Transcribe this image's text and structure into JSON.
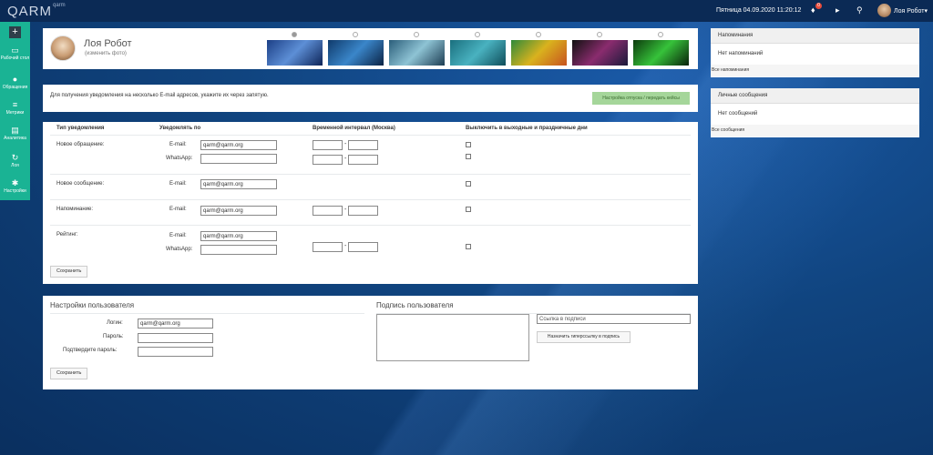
{
  "app": {
    "logo": "QARM",
    "logo_sub": "qarm"
  },
  "topbar": {
    "datetime": "Пятница 04.09.2020 11:20:12",
    "bell_count": "0",
    "user_name": "Лоя Робот",
    "caret": "▾"
  },
  "sidebar": {
    "add_label": "+",
    "items": [
      {
        "label": "Рабочий стол",
        "icon": "monitor-icon",
        "glyph": "▭"
      },
      {
        "label": "Обращения",
        "icon": "comment-icon",
        "glyph": "●"
      },
      {
        "label": "Метрики",
        "icon": "list-icon",
        "glyph": "≡"
      },
      {
        "label": "Аналитика",
        "icon": "chart-icon",
        "glyph": "▤"
      },
      {
        "label": "Лоя",
        "icon": "refresh-icon",
        "glyph": "↻"
      },
      {
        "label": "Настройки",
        "icon": "gear-icon",
        "glyph": "✱"
      }
    ]
  },
  "profile": {
    "name": "Лоя Робот",
    "change_photo": "(изменить фото)",
    "themes": [
      {
        "selected": true,
        "colors": [
          "#1c3f86",
          "#5d8fd6",
          "#0d2457"
        ]
      },
      {
        "selected": false,
        "colors": [
          "#0f3a6b",
          "#3a86c9",
          "#0b2344"
        ]
      },
      {
        "selected": false,
        "colors": [
          "#2a5d7a",
          "#8ec3d4",
          "#1d3d52"
        ]
      },
      {
        "selected": false,
        "colors": [
          "#1a6f7e",
          "#49b2c0",
          "#0f4d5a"
        ]
      },
      {
        "selected": false,
        "colors": [
          "#2e8a3a",
          "#d9b21e",
          "#c7531f"
        ]
      },
      {
        "selected": false,
        "colors": [
          "#111111",
          "#8a2c6e",
          "#1a1a3a"
        ]
      },
      {
        "selected": false,
        "colors": [
          "#0d3a0d",
          "#36c23a",
          "#0a220a"
        ]
      }
    ]
  },
  "notice": {
    "text": "Для получения уведомления на несколько E-mail адресов, укажите их через запятую.",
    "button": "Настройка отпуска / передать кейсы"
  },
  "notify": {
    "headers": {
      "type": "Тип уведомления",
      "notify_by": "Уведомлять по",
      "interval": "Временной интервал (Москва)",
      "weekends": "Выключить в выходные и праздничные дни"
    },
    "email_label": "E-mail:",
    "whatsapp_label": "WhatsApp:",
    "dash": "-",
    "rows": [
      {
        "type": "Новое обращение:",
        "email": "qarm@qarm.org",
        "whatsapp": ""
      },
      {
        "type": "Новое сообщение:",
        "email": "qarm@qarm.org"
      },
      {
        "type": "Напоминание:",
        "email": "qarm@qarm.org"
      },
      {
        "type": "Рейтинг:",
        "email": "qarm@qarm.org",
        "whatsapp": ""
      }
    ],
    "save": "Сохранить"
  },
  "user_settings": {
    "title": "Настройки пользователя",
    "login_label": "Логин:",
    "login_value": "qarm@qarm.org",
    "password_label": "Пароль:",
    "confirm_label": "Подтвердите пароль:",
    "save": "Сохранить"
  },
  "signature": {
    "title": "Подпись пользователя",
    "link_placeholder": "Ссылка в подписи",
    "link_button": "Назначить гиперссылку в подпись"
  },
  "reminders": {
    "title": "Напоминания",
    "empty": "Нет напоминаний",
    "footer": "Все напоминания"
  },
  "messages": {
    "title": "Личные сообщения",
    "empty": "Нет сообщений",
    "footer": "Все сообщения"
  }
}
